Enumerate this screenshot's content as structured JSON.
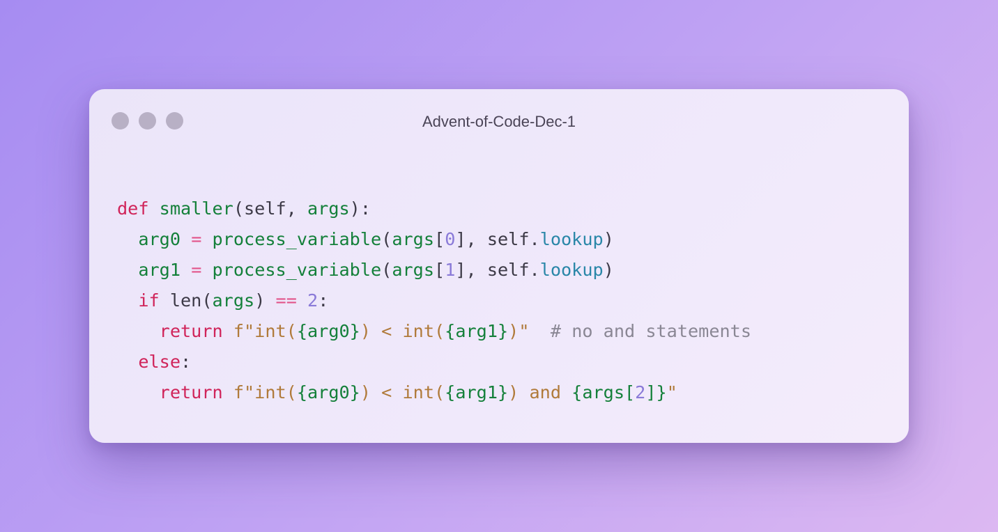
{
  "window": {
    "title": "Advent-of-Code-Dec-1",
    "dots": [
      "window-dot",
      "window-dot",
      "window-dot"
    ]
  },
  "code": {
    "lines": [
      [
        {
          "t": "def",
          "c": "kw"
        },
        {
          "t": " ",
          "c": "plain"
        },
        {
          "t": "smaller",
          "c": "fn"
        },
        {
          "t": "(self, ",
          "c": "plain"
        },
        {
          "t": "args",
          "c": "var"
        },
        {
          "t": "):",
          "c": "plain"
        }
      ],
      [
        {
          "t": "  ",
          "c": "plain"
        },
        {
          "t": "arg0",
          "c": "var"
        },
        {
          "t": " ",
          "c": "plain"
        },
        {
          "t": "=",
          "c": "op"
        },
        {
          "t": " ",
          "c": "plain"
        },
        {
          "t": "process_variable",
          "c": "fn"
        },
        {
          "t": "(",
          "c": "plain"
        },
        {
          "t": "args",
          "c": "var"
        },
        {
          "t": "[",
          "c": "plain"
        },
        {
          "t": "0",
          "c": "num"
        },
        {
          "t": "], self.",
          "c": "plain"
        },
        {
          "t": "lookup",
          "c": "attr"
        },
        {
          "t": ")",
          "c": "plain"
        }
      ],
      [
        {
          "t": "  ",
          "c": "plain"
        },
        {
          "t": "arg1",
          "c": "var"
        },
        {
          "t": " ",
          "c": "plain"
        },
        {
          "t": "=",
          "c": "op"
        },
        {
          "t": " ",
          "c": "plain"
        },
        {
          "t": "process_variable",
          "c": "fn"
        },
        {
          "t": "(",
          "c": "plain"
        },
        {
          "t": "args",
          "c": "var"
        },
        {
          "t": "[",
          "c": "plain"
        },
        {
          "t": "1",
          "c": "num"
        },
        {
          "t": "], self.",
          "c": "plain"
        },
        {
          "t": "lookup",
          "c": "attr"
        },
        {
          "t": ")",
          "c": "plain"
        }
      ],
      [
        {
          "t": "  ",
          "c": "plain"
        },
        {
          "t": "if",
          "c": "kw"
        },
        {
          "t": " len(",
          "c": "plain"
        },
        {
          "t": "args",
          "c": "var"
        },
        {
          "t": ") ",
          "c": "plain"
        },
        {
          "t": "==",
          "c": "op"
        },
        {
          "t": " ",
          "c": "plain"
        },
        {
          "t": "2",
          "c": "num"
        },
        {
          "t": ":",
          "c": "plain"
        }
      ],
      [
        {
          "t": "    ",
          "c": "plain"
        },
        {
          "t": "return",
          "c": "kw"
        },
        {
          "t": " ",
          "c": "plain"
        },
        {
          "t": "f\"int(",
          "c": "str"
        },
        {
          "t": "{arg0}",
          "c": "var"
        },
        {
          "t": ") < int(",
          "c": "str"
        },
        {
          "t": "{arg1}",
          "c": "var"
        },
        {
          "t": ")\"",
          "c": "str"
        },
        {
          "t": "  ",
          "c": "plain"
        },
        {
          "t": "# no and statements",
          "c": "cmt"
        }
      ],
      [
        {
          "t": "  ",
          "c": "plain"
        },
        {
          "t": "else",
          "c": "kw"
        },
        {
          "t": ":",
          "c": "plain"
        }
      ],
      [
        {
          "t": "    ",
          "c": "plain"
        },
        {
          "t": "return",
          "c": "kw"
        },
        {
          "t": " ",
          "c": "plain"
        },
        {
          "t": "f\"int(",
          "c": "str"
        },
        {
          "t": "{arg0}",
          "c": "var"
        },
        {
          "t": ") < int(",
          "c": "str"
        },
        {
          "t": "{arg1}",
          "c": "var"
        },
        {
          "t": ") and ",
          "c": "str"
        },
        {
          "t": "{args[",
          "c": "var"
        },
        {
          "t": "2",
          "c": "num"
        },
        {
          "t": "]}",
          "c": "var"
        },
        {
          "t": "\"",
          "c": "str"
        }
      ]
    ]
  }
}
